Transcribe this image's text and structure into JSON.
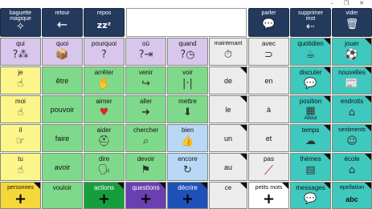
{
  "window": {
    "minimize": "–",
    "restore": "❐",
    "close": "✕"
  },
  "toolbar": {
    "magic": {
      "label1": "baguette",
      "label2": "magique",
      "icon": "✧"
    },
    "back": {
      "label": "retour",
      "icon": "←"
    },
    "rest": {
      "label": "repos",
      "icon": "zzᶻ"
    },
    "speak": {
      "label": "parler",
      "icon": "💬"
    },
    "delete_word": {
      "label1": "supprimer",
      "label2": "mot",
      "icon": "⇠"
    },
    "clear": {
      "label": "vider",
      "icon": "🗑"
    }
  },
  "message": "",
  "grid": {
    "row1": [
      "qui",
      "quoi",
      "pourquoi",
      "où",
      "quand",
      "maintenant",
      "avec",
      "quotidien",
      "jouer"
    ],
    "row2": [
      "je",
      "être",
      "arrêter",
      "venir",
      "voir",
      "de",
      "en",
      "discuter",
      "nouvelles"
    ],
    "row3": [
      "moi",
      "pouvoir",
      "aimer",
      "aller",
      "mettre",
      "le",
      "à",
      "position",
      "endroits"
    ],
    "row4": [
      "il",
      "faire",
      "aider",
      "chercher",
      "bien",
      "un",
      "et",
      "temps",
      "sentiments"
    ],
    "row5": [
      "tu",
      "avoir",
      "dire",
      "devoir",
      "encore",
      "au",
      "pas",
      "thèmes",
      "école"
    ],
    "row6": [
      "personnes",
      "vouloir",
      "actions",
      "questions",
      "décrire",
      "ce",
      "petits mots",
      "messages",
      "epellation"
    ],
    "extra": {
      "pos_subtitle": "About",
      "abc": "abc"
    }
  },
  "icons": {
    "qui": "?⁂",
    "quoi": "📦",
    "pourquoi": "?",
    "ou": "?⇥",
    "quand": "?◷",
    "maintenant": "⏱",
    "avec": "⊃",
    "quotidien": "☕",
    "jouer": "⚽",
    "je": "☝",
    "arreter": "✋",
    "venir": "↪",
    "voir": "|·|",
    "discuter": "💬",
    "nouvelles": "📰",
    "moi": "☝",
    "aimer": "♥",
    "aller": "➜",
    "mettre": "⬇",
    "position": "▦",
    "endroits": "⌂",
    "il": "☞",
    "aider": "⛑",
    "chercher": "⌕",
    "bien": "👍",
    "temps": "☁",
    "sentiments": "☺",
    "tu": "☝",
    "dire": "🗣",
    "devoir": "⚑",
    "encore": "↻",
    "pas": "⟋",
    "themes": "▤",
    "ecole": "⌂",
    "plus": "+",
    "messages": "💬"
  },
  "colors": {
    "toolbar": "#243a5c",
    "purple": "#d9c6ec",
    "yellow": "#fbf58a",
    "green": "#7fd98a",
    "blue": "#b8d8f5",
    "white": "#ececec",
    "teal": "#3fc8bd",
    "dark_green": "#179e3c",
    "dark_blue": "#1f52b8",
    "dark_purple": "#6a3fb0",
    "gold": "#f6d73a"
  }
}
